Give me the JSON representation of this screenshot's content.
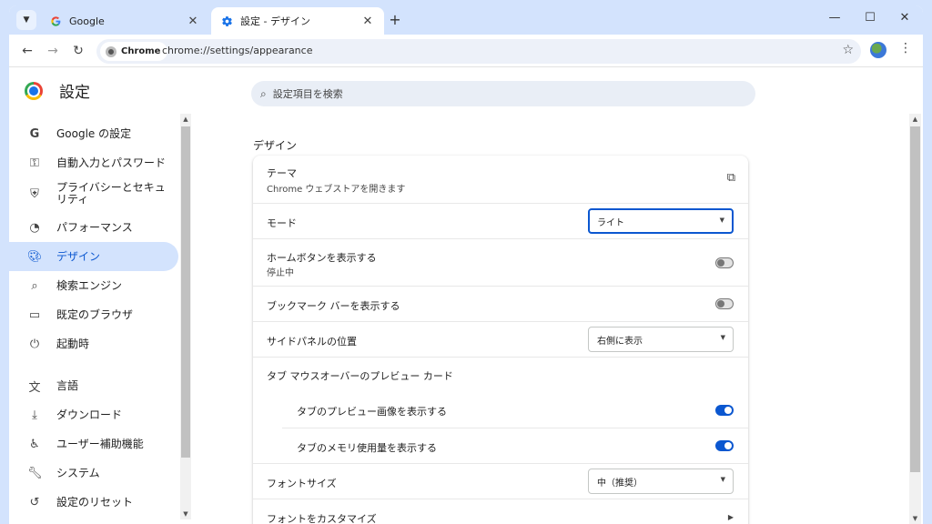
{
  "tabs": [
    {
      "title": "Google",
      "icon": "google-g-icon"
    },
    {
      "title": "設定 - デザイン",
      "icon": "settings-gear-icon"
    }
  ],
  "toolbar": {
    "chip_label": "Chrome",
    "url": "chrome://settings/appearance"
  },
  "settings": {
    "brand": "設定",
    "search_placeholder": "設定項目を検索",
    "sidebar": [
      {
        "label": "Google の設定",
        "icon": "google-g-icon"
      },
      {
        "label": "自動入力とパスワード",
        "icon": "key-icon"
      },
      {
        "label": "プライバシーとセキュリティ",
        "icon": "shield-icon"
      },
      {
        "label": "パフォーマンス",
        "icon": "speedometer-icon"
      },
      {
        "label": "デザイン",
        "icon": "palette-icon",
        "selected": true
      },
      {
        "label": "検索エンジン",
        "icon": "search-icon"
      },
      {
        "label": "既定のブラウザ",
        "icon": "browser-window-icon"
      },
      {
        "label": "起動時",
        "icon": "power-icon"
      },
      {
        "label": "言語",
        "icon": "translate-icon"
      },
      {
        "label": "ダウンロード",
        "icon": "download-icon"
      },
      {
        "label": "ユーザー補助機能",
        "icon": "accessibility-icon"
      },
      {
        "label": "システム",
        "icon": "wrench-icon"
      },
      {
        "label": "設定のリセット",
        "icon": "reset-icon"
      }
    ],
    "section_title": "デザイン",
    "theme": {
      "label": "テーマ",
      "sub": "Chrome ウェブストアを開きます"
    },
    "mode": {
      "label": "モード",
      "value": "ライト"
    },
    "home_button": {
      "label": "ホームボタンを表示する",
      "sub": "停止中",
      "enabled": false
    },
    "bookmarks_bar": {
      "label": "ブックマーク バーを表示する",
      "enabled": false
    },
    "side_panel": {
      "label": "サイドパネルの位置",
      "value": "右側に表示"
    },
    "tab_hover": {
      "label": "タブ マウスオーバーのプレビュー カード"
    },
    "tab_preview_image": {
      "label": "タブのプレビュー画像を表示する",
      "enabled": true
    },
    "tab_memory": {
      "label": "タブのメモリ使用量を表示する",
      "enabled": true
    },
    "font_size": {
      "label": "フォントサイズ",
      "value": "中（推奨）"
    },
    "customize_fonts": {
      "label": "フォントをカスタマイズ"
    }
  }
}
